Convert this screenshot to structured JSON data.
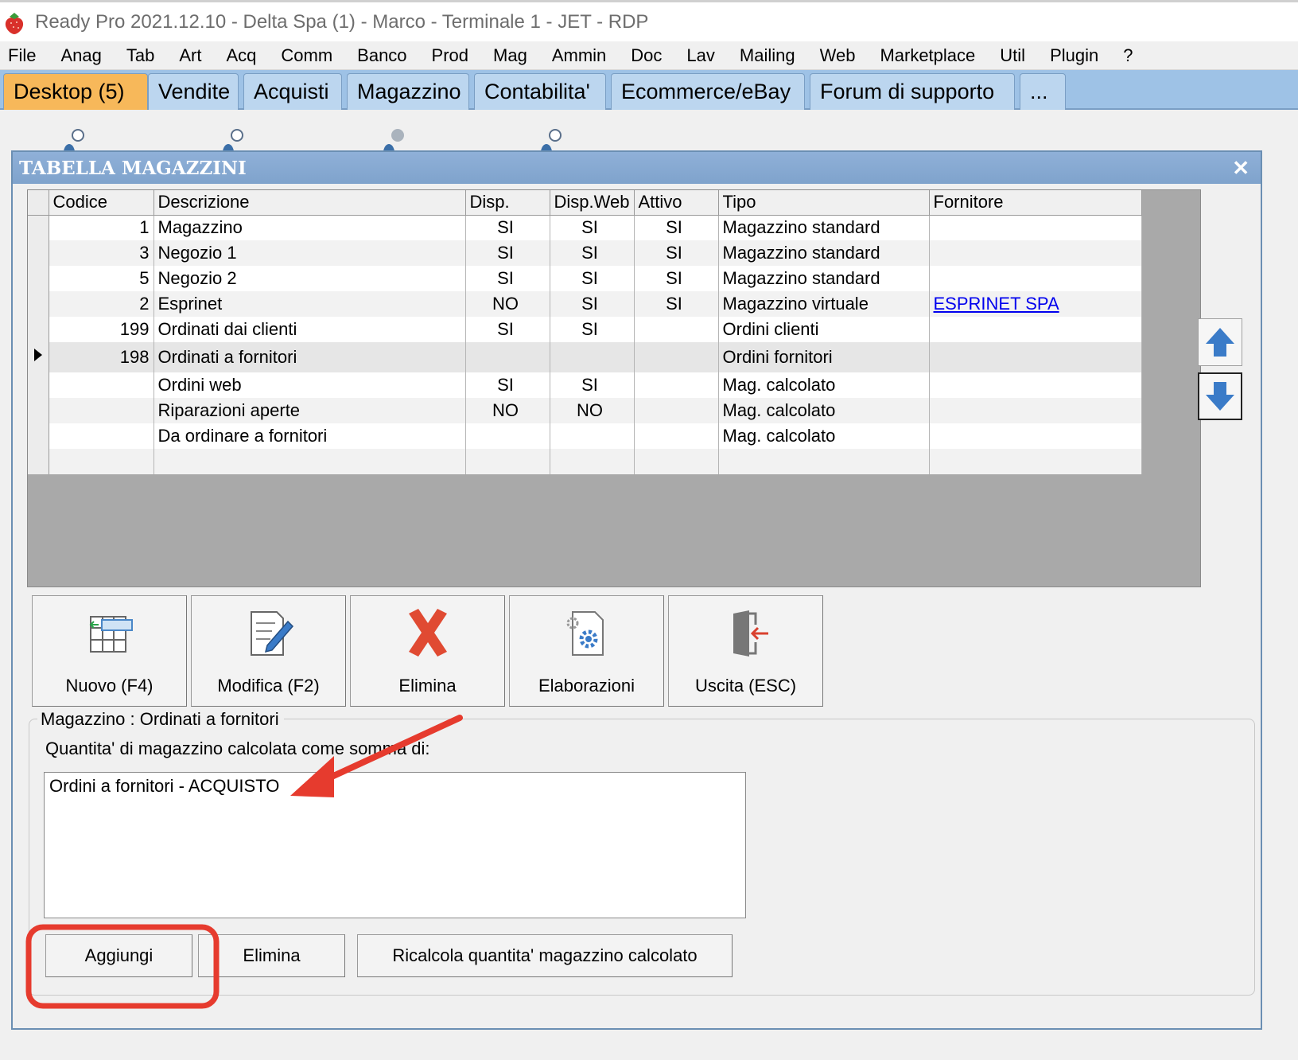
{
  "window": {
    "title": "Ready Pro 2021.12.10 - Delta Spa (1) - Marco - Terminale 1 - JET - RDP"
  },
  "menu": [
    "File",
    "Anag",
    "Tab",
    "Art",
    "Acq",
    "Comm",
    "Banco",
    "Prod",
    "Mag",
    "Ammin",
    "Doc",
    "Lav",
    "Mailing",
    "Web",
    "Marketplace",
    "Util",
    "Plugin",
    "?"
  ],
  "tabs": [
    {
      "label": "Desktop (5)",
      "active": true
    },
    {
      "label": "Vendite"
    },
    {
      "label": "Acquisti"
    },
    {
      "label": "Magazzino"
    },
    {
      "label": "Contabilita'"
    },
    {
      "label": "Ecommerce/eBay"
    },
    {
      "label": "Forum di supporto"
    },
    {
      "label": "..."
    }
  ],
  "dialog": {
    "title": "TABELLA MAGAZZINI",
    "columns": [
      "Codice",
      "Descrizione",
      "Disp.",
      "Disp.Web",
      "Attivo",
      "Tipo",
      "Fornitore"
    ],
    "rows": [
      [
        "1",
        "Magazzino",
        "SI",
        "SI",
        "SI",
        "Magazzino standard",
        ""
      ],
      [
        "3",
        "Negozio 1",
        "SI",
        "SI",
        "SI",
        "Magazzino standard",
        ""
      ],
      [
        "5",
        "Negozio 2",
        "SI",
        "SI",
        "SI",
        "Magazzino standard",
        ""
      ],
      [
        "2",
        "Esprinet",
        "NO",
        "SI",
        "SI",
        "Magazzino virtuale",
        "ESPRINET SPA"
      ],
      [
        "199",
        "Ordinati dai clienti",
        "SI",
        "SI",
        "",
        "Ordini clienti",
        ""
      ],
      [
        "198",
        "Ordinati a fornitori",
        "",
        "",
        "",
        "Ordini fornitori",
        ""
      ],
      [
        "",
        "Ordini web",
        "SI",
        "SI",
        "",
        "Mag. calcolato",
        ""
      ],
      [
        "",
        "Riparazioni aperte",
        "NO",
        "NO",
        "",
        "Mag. calcolato",
        ""
      ],
      [
        "",
        "Da ordinare a fornitori",
        "",
        "",
        "",
        "Mag. calcolato",
        ""
      ]
    ],
    "selected_row": 5,
    "toolbar": [
      {
        "label": "Nuovo (F4)",
        "icon": "new-record-icon"
      },
      {
        "label": "Modifica (F2)",
        "icon": "edit-document-icon"
      },
      {
        "label": "Elimina",
        "icon": "delete-x-icon"
      },
      {
        "label": "Elaborazioni",
        "icon": "gear-document-icon"
      },
      {
        "label": "Uscita (ESC)",
        "icon": "exit-door-icon"
      }
    ],
    "group": {
      "legend": "Magazzino : Ordinati a fornitori",
      "description": "Quantita' di magazzino calcolata come somma di:",
      "list_items": [
        "Ordini a fornitori - ACQUISTO"
      ],
      "buttons": {
        "add": "Aggiungi",
        "delete": "Elimina",
        "recalc": "Ricalcola quantita' magazzino calcolato"
      }
    }
  },
  "colors": {
    "tab_strip": "#9ec2e6",
    "tab_active": "#f7b85a",
    "dialog_title": "#7fa3cc",
    "annotation_red": "#e63b2e",
    "link": "#0000ee"
  }
}
